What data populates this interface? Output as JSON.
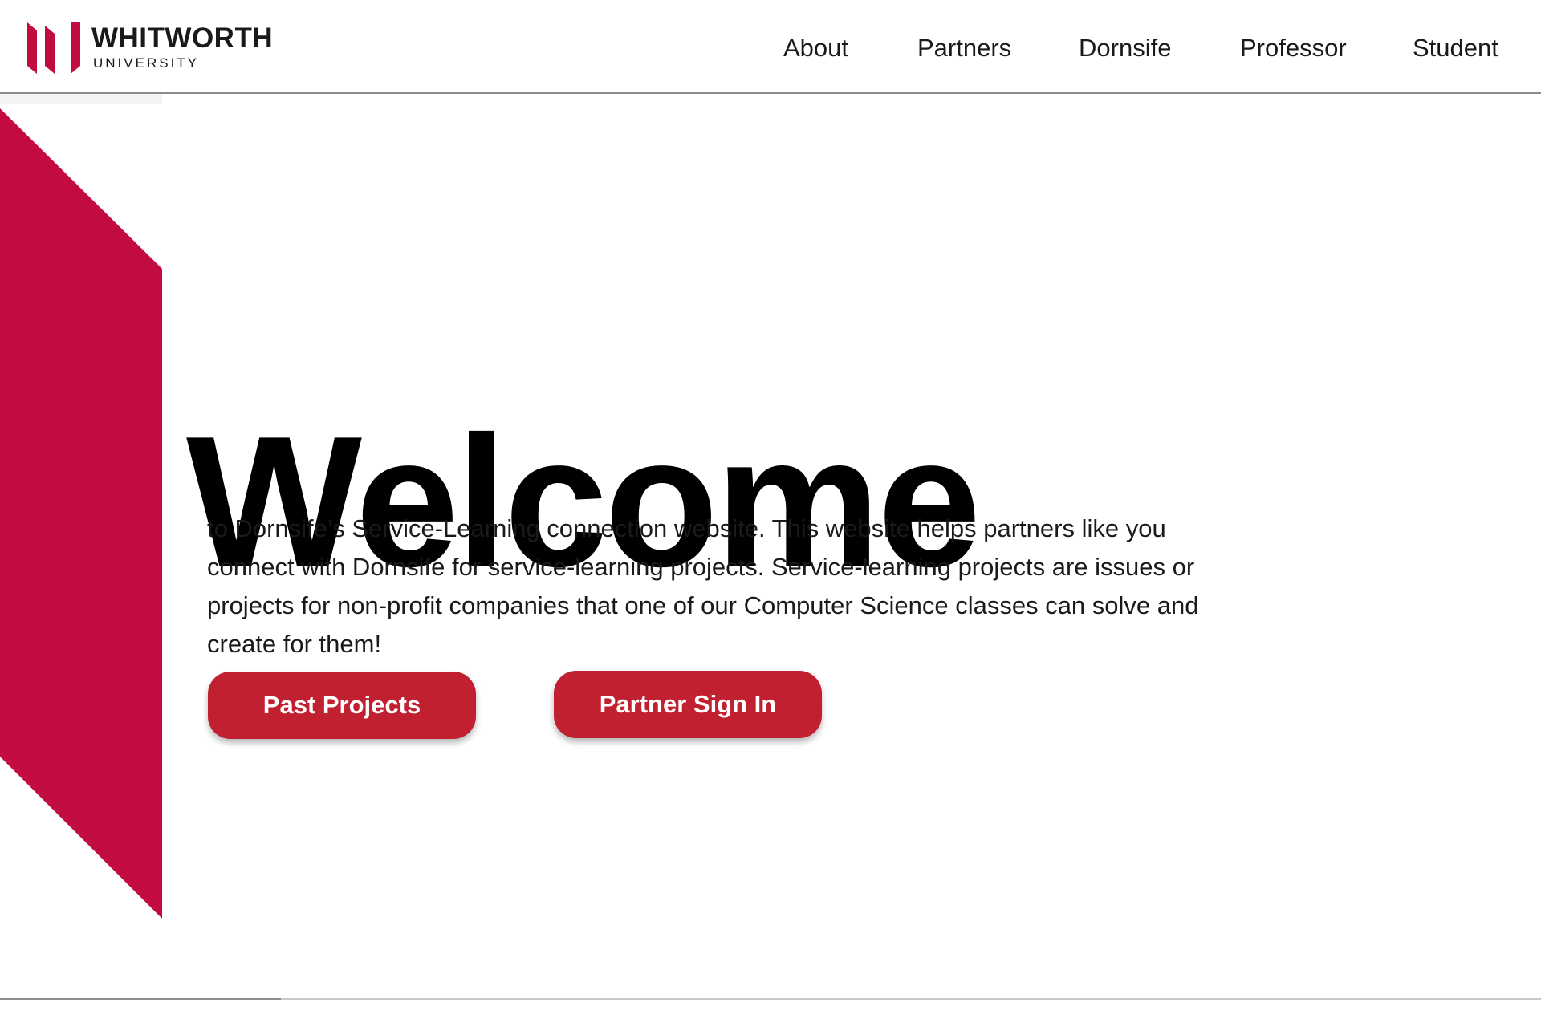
{
  "brand": {
    "name": "WHITWORTH",
    "subtitle": "UNIVERSITY",
    "accent_color": "#c20b3f",
    "button_color": "#c12030",
    "logo_icon": "whitworth-logo-icon"
  },
  "nav": {
    "items": [
      {
        "label": "About"
      },
      {
        "label": "Partners"
      },
      {
        "label": "Dornsife"
      },
      {
        "label": "Professor"
      },
      {
        "label": "Student"
      }
    ]
  },
  "hero": {
    "heading": "Welcome",
    "intro": "to Dornsife’s Service-Learning connection website. This website helps partners like you connect with Dornsife for service-learning projects. Service-learning projects are issues or projects for non-profit companies that one of our Computer Science classes can solve and create for them!",
    "buttons": {
      "past_projects": "Past Projects",
      "partner_sign_in": "Partner Sign In"
    }
  }
}
